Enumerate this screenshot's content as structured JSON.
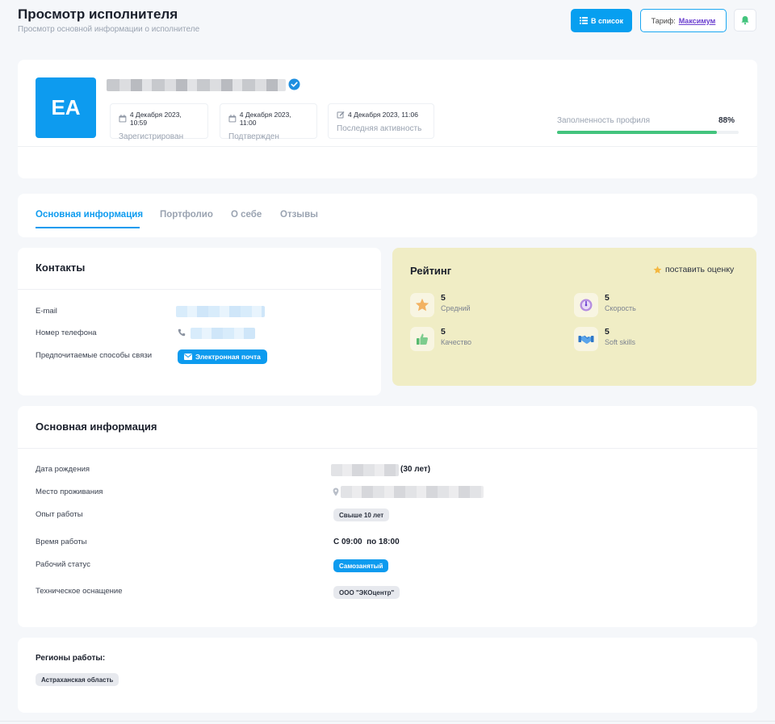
{
  "header": {
    "title": "Просмотр исполнителя",
    "subtitle": "Просмотр основной информации о исполнителе",
    "list_button": "В список",
    "tariff_label": "Тариф:",
    "tariff_value": "Максимум"
  },
  "profile": {
    "initials": "EA",
    "dates": [
      {
        "date": "4 Декабря 2023, 10:59",
        "label": "Зарегистрирован"
      },
      {
        "date": "4 Декабря 2023, 11:00",
        "label": "Подтвержден"
      },
      {
        "date": "4 Декабря 2023, 11:06",
        "label": "Последняя активность"
      }
    ],
    "fill_label": "Заполненность профиля",
    "fill_value": "88%",
    "fill_fraction": 0.88
  },
  "tabs": [
    "Основная информация",
    "Портфолио",
    "О себе",
    "Отзывы"
  ],
  "contacts": {
    "title": "Контакты",
    "email_label": "E-mail",
    "phone_label": "Номер телефона",
    "preferred_label": "Предпочитаемые способы связи",
    "preferred_value": "Электронная почта"
  },
  "rating": {
    "title": "Рейтинг",
    "action": "поставить оценку",
    "items": [
      {
        "value": "5",
        "label": "Средний",
        "icon": "star-icon"
      },
      {
        "value": "5",
        "label": "Скорость",
        "icon": "speedometer-icon"
      },
      {
        "value": "5",
        "label": "Качество",
        "icon": "thumbs-up-icon"
      },
      {
        "value": "5",
        "label": "Soft skills",
        "icon": "handshake-icon"
      }
    ]
  },
  "basic": {
    "title": "Основная информация",
    "birth_label": "Дата рождения",
    "birth_age": "(30 лет)",
    "residence_label": "Место проживания",
    "experience_label": "Опыт работы",
    "experience_value": "Свыше 10 лет",
    "hours_label": "Время работы",
    "hours_value": "С 09:00  по 18:00",
    "status_label": "Рабочий статус",
    "status_value": "Самозанятый",
    "equipment_label": "Техническое оснащение",
    "equipment_value": "ООО \"ЭКОцентр\""
  },
  "regions": {
    "title": "Регионы работы:",
    "items": [
      "Астраханская область"
    ]
  },
  "colors": {
    "primary": "#0d9bef",
    "rating_bg": "#f0edc5",
    "progress": "#43c47d",
    "tariff": "#6a3fcf"
  }
}
